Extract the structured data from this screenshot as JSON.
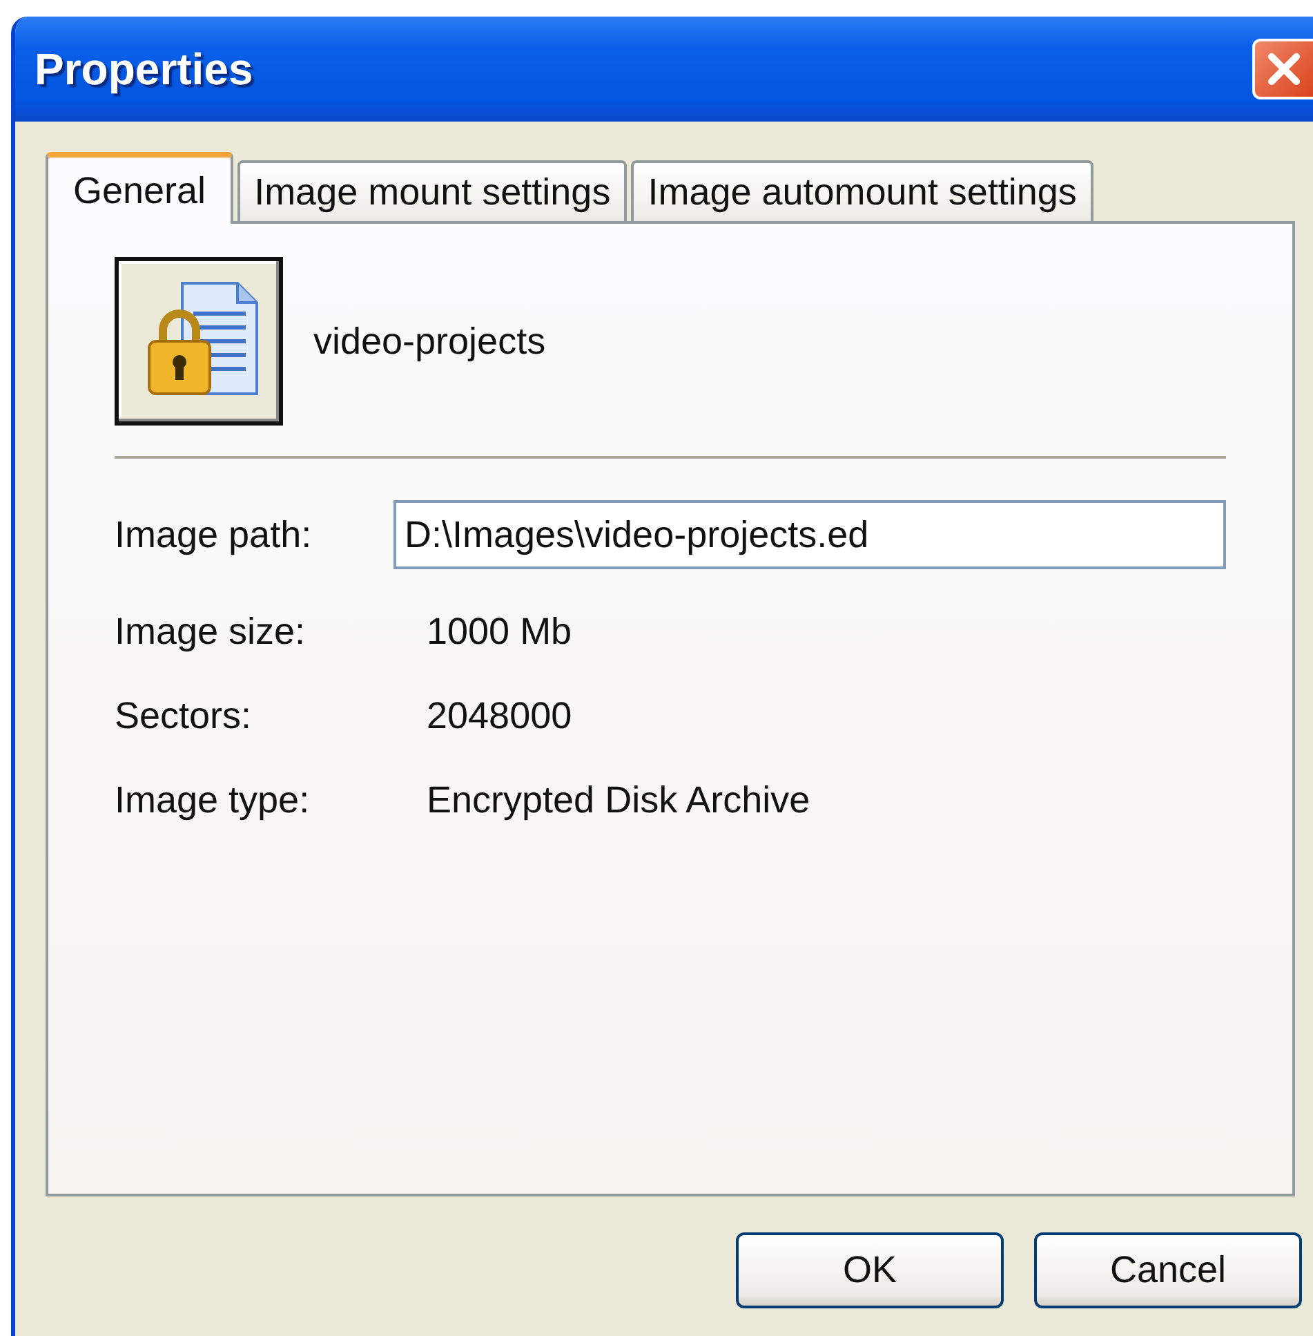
{
  "window": {
    "title": "Properties"
  },
  "tabs": [
    {
      "label": "General",
      "selected": true
    },
    {
      "label": "Image mount settings",
      "selected": false
    },
    {
      "label": "Image automount settings",
      "selected": false
    }
  ],
  "image_name": "video-projects",
  "path": {
    "label": "Image path:",
    "value": "D:\\Images\\video-projects.ed"
  },
  "details": [
    {
      "label": "Image size:",
      "value": "1000  Mb"
    },
    {
      "label": "Sectors:",
      "value": "2048000"
    },
    {
      "label": "Image type:",
      "value": "Encrypted Disk Archive"
    }
  ],
  "buttons": [
    "OK",
    "Cancel"
  ]
}
